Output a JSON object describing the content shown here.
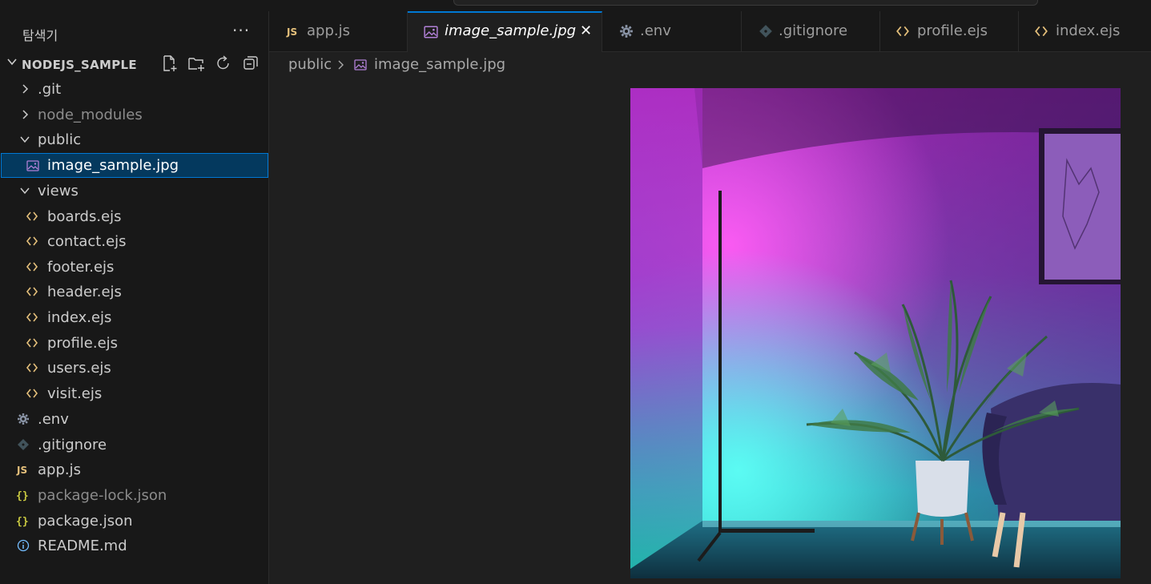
{
  "sidebar": {
    "title": "탐색기",
    "more_label": "···",
    "project_name": "NODEJS_SAMPLE",
    "header_actions": [
      "new-file",
      "new-folder",
      "refresh",
      "collapse-all"
    ],
    "items": [
      {
        "label": ".git",
        "type": "folder",
        "expanded": false,
        "indent": 0
      },
      {
        "label": "node_modules",
        "type": "folder",
        "expanded": false,
        "indent": 0,
        "dim": true
      },
      {
        "label": "public",
        "type": "folder",
        "expanded": true,
        "indent": 0
      },
      {
        "label": "image_sample.jpg",
        "type": "image",
        "indent": 1,
        "selected": true
      },
      {
        "label": "views",
        "type": "folder",
        "expanded": true,
        "indent": 0
      },
      {
        "label": "boards.ejs",
        "type": "ejs",
        "indent": 1
      },
      {
        "label": "contact.ejs",
        "type": "ejs",
        "indent": 1
      },
      {
        "label": "footer.ejs",
        "type": "ejs",
        "indent": 1
      },
      {
        "label": "header.ejs",
        "type": "ejs",
        "indent": 1
      },
      {
        "label": "index.ejs",
        "type": "ejs",
        "indent": 1
      },
      {
        "label": "profile.ejs",
        "type": "ejs",
        "indent": 1
      },
      {
        "label": "users.ejs",
        "type": "ejs",
        "indent": 1
      },
      {
        "label": "visit.ejs",
        "type": "ejs",
        "indent": 1
      },
      {
        "label": ".env",
        "type": "env",
        "indent": 0
      },
      {
        "label": ".gitignore",
        "type": "git",
        "indent": 0
      },
      {
        "label": "app.js",
        "type": "js",
        "indent": 0
      },
      {
        "label": "package-lock.json",
        "type": "json",
        "indent": 0,
        "dim": true
      },
      {
        "label": "package.json",
        "type": "json",
        "indent": 0
      },
      {
        "label": "README.md",
        "type": "info",
        "indent": 0
      }
    ]
  },
  "tabs": [
    {
      "label": "app.js",
      "type": "js"
    },
    {
      "label": "image_sample.jpg",
      "type": "image",
      "active": true,
      "close_label": "✕"
    },
    {
      "label": ".env",
      "type": "env"
    },
    {
      "label": ".gitignore",
      "type": "git"
    },
    {
      "label": "profile.ejs",
      "type": "ejs"
    },
    {
      "label": "index.ejs",
      "type": "ejs"
    }
  ],
  "breadcrumb": {
    "folder": "public",
    "file": "image_sample.jpg"
  },
  "colors": {
    "accent": "#0078d4",
    "selection": "#04395e",
    "ejs_icon": "#e5c07b",
    "image_icon": "#b180d7",
    "info_icon": "#75beff",
    "json_icon": "#cbcb41"
  }
}
